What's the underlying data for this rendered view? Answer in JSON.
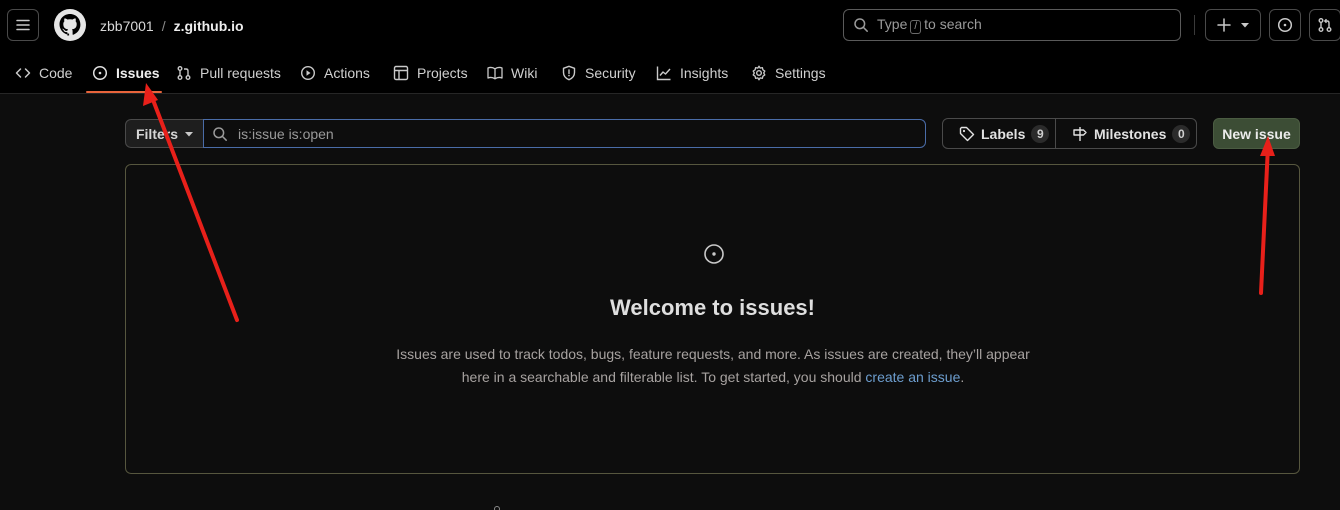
{
  "header": {
    "owner": "zbb7001",
    "separator": "/",
    "repo": "z.github.io",
    "search": {
      "prefix": "Type",
      "key": "/",
      "suffix": "to search"
    },
    "icons": [
      "menu-icon",
      "github-logo-icon",
      "search-icon",
      "plus-icon",
      "triangle-down-icon",
      "issue-opened-icon",
      "git-pull-request-icon"
    ]
  },
  "tabs": [
    {
      "label": "Code",
      "icon": "code-icon"
    },
    {
      "label": "Issues",
      "icon": "issue-opened-icon",
      "active": true
    },
    {
      "label": "Pull requests",
      "icon": "git-pull-request-icon"
    },
    {
      "label": "Actions",
      "icon": "play-icon"
    },
    {
      "label": "Projects",
      "icon": "table-icon"
    },
    {
      "label": "Wiki",
      "icon": "book-icon"
    },
    {
      "label": "Security",
      "icon": "shield-icon"
    },
    {
      "label": "Insights",
      "icon": "graph-icon"
    },
    {
      "label": "Settings",
      "icon": "gear-icon"
    }
  ],
  "toolbar": {
    "filters_label": "Filters",
    "search_value": "is:issue is:open",
    "labels_label": "Labels",
    "labels_count": "9",
    "milestones_label": "Milestones",
    "milestones_count": "0",
    "new_issue_label": "New issue"
  },
  "blankslate": {
    "title": "Welcome to issues!",
    "text_before": "Issues are used to track todos, bugs, feature requests, and more. As issues are created, they’ll appear here in a searchable and filterable list. To get started, you should ",
    "link": "create an issue",
    "text_after": "."
  },
  "colors": {
    "background": "#0d0d0d",
    "header": "#000000",
    "tab_underline": "#e8643b",
    "new_issue_button": "#3c4d35",
    "link": "#6d9ecf",
    "annotation_arrow": "#e8201a"
  }
}
